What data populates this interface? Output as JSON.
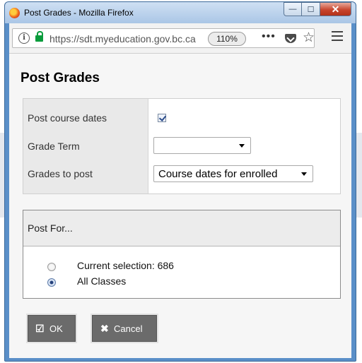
{
  "window": {
    "title": "Post Grades - Mozilla Firefox",
    "controls": {
      "minimize": "—",
      "maximize": "☐",
      "close": "✕"
    }
  },
  "browser": {
    "url": "https://sdt.myeducation.gov.bc.ca",
    "zoom": "110%",
    "icons": [
      "info-icon",
      "lock-icon",
      "page-actions-icon",
      "pocket-icon",
      "bookmark-star-icon",
      "hamburger-menu-icon"
    ]
  },
  "page": {
    "title": "Post Grades",
    "form": {
      "post_course_dates_label": "Post course dates",
      "post_course_dates_checked": true,
      "grade_term_label": "Grade Term",
      "grade_term_value": "",
      "grades_to_post_label": "Grades to post",
      "grades_to_post_value": "Course dates for enrolled"
    },
    "post_for": {
      "title": "Post For...",
      "options": [
        {
          "label": "Current selection: 686",
          "checked": false
        },
        {
          "label": "All Classes",
          "checked": true
        }
      ]
    },
    "buttons": {
      "ok": "OK",
      "cancel": "Cancel"
    }
  },
  "colors": {
    "window_frame": "#5a8fc8",
    "button_bg": "#6b6b6b",
    "label_column": "#e9e9e9",
    "lock_green": "#0a9c3c"
  }
}
